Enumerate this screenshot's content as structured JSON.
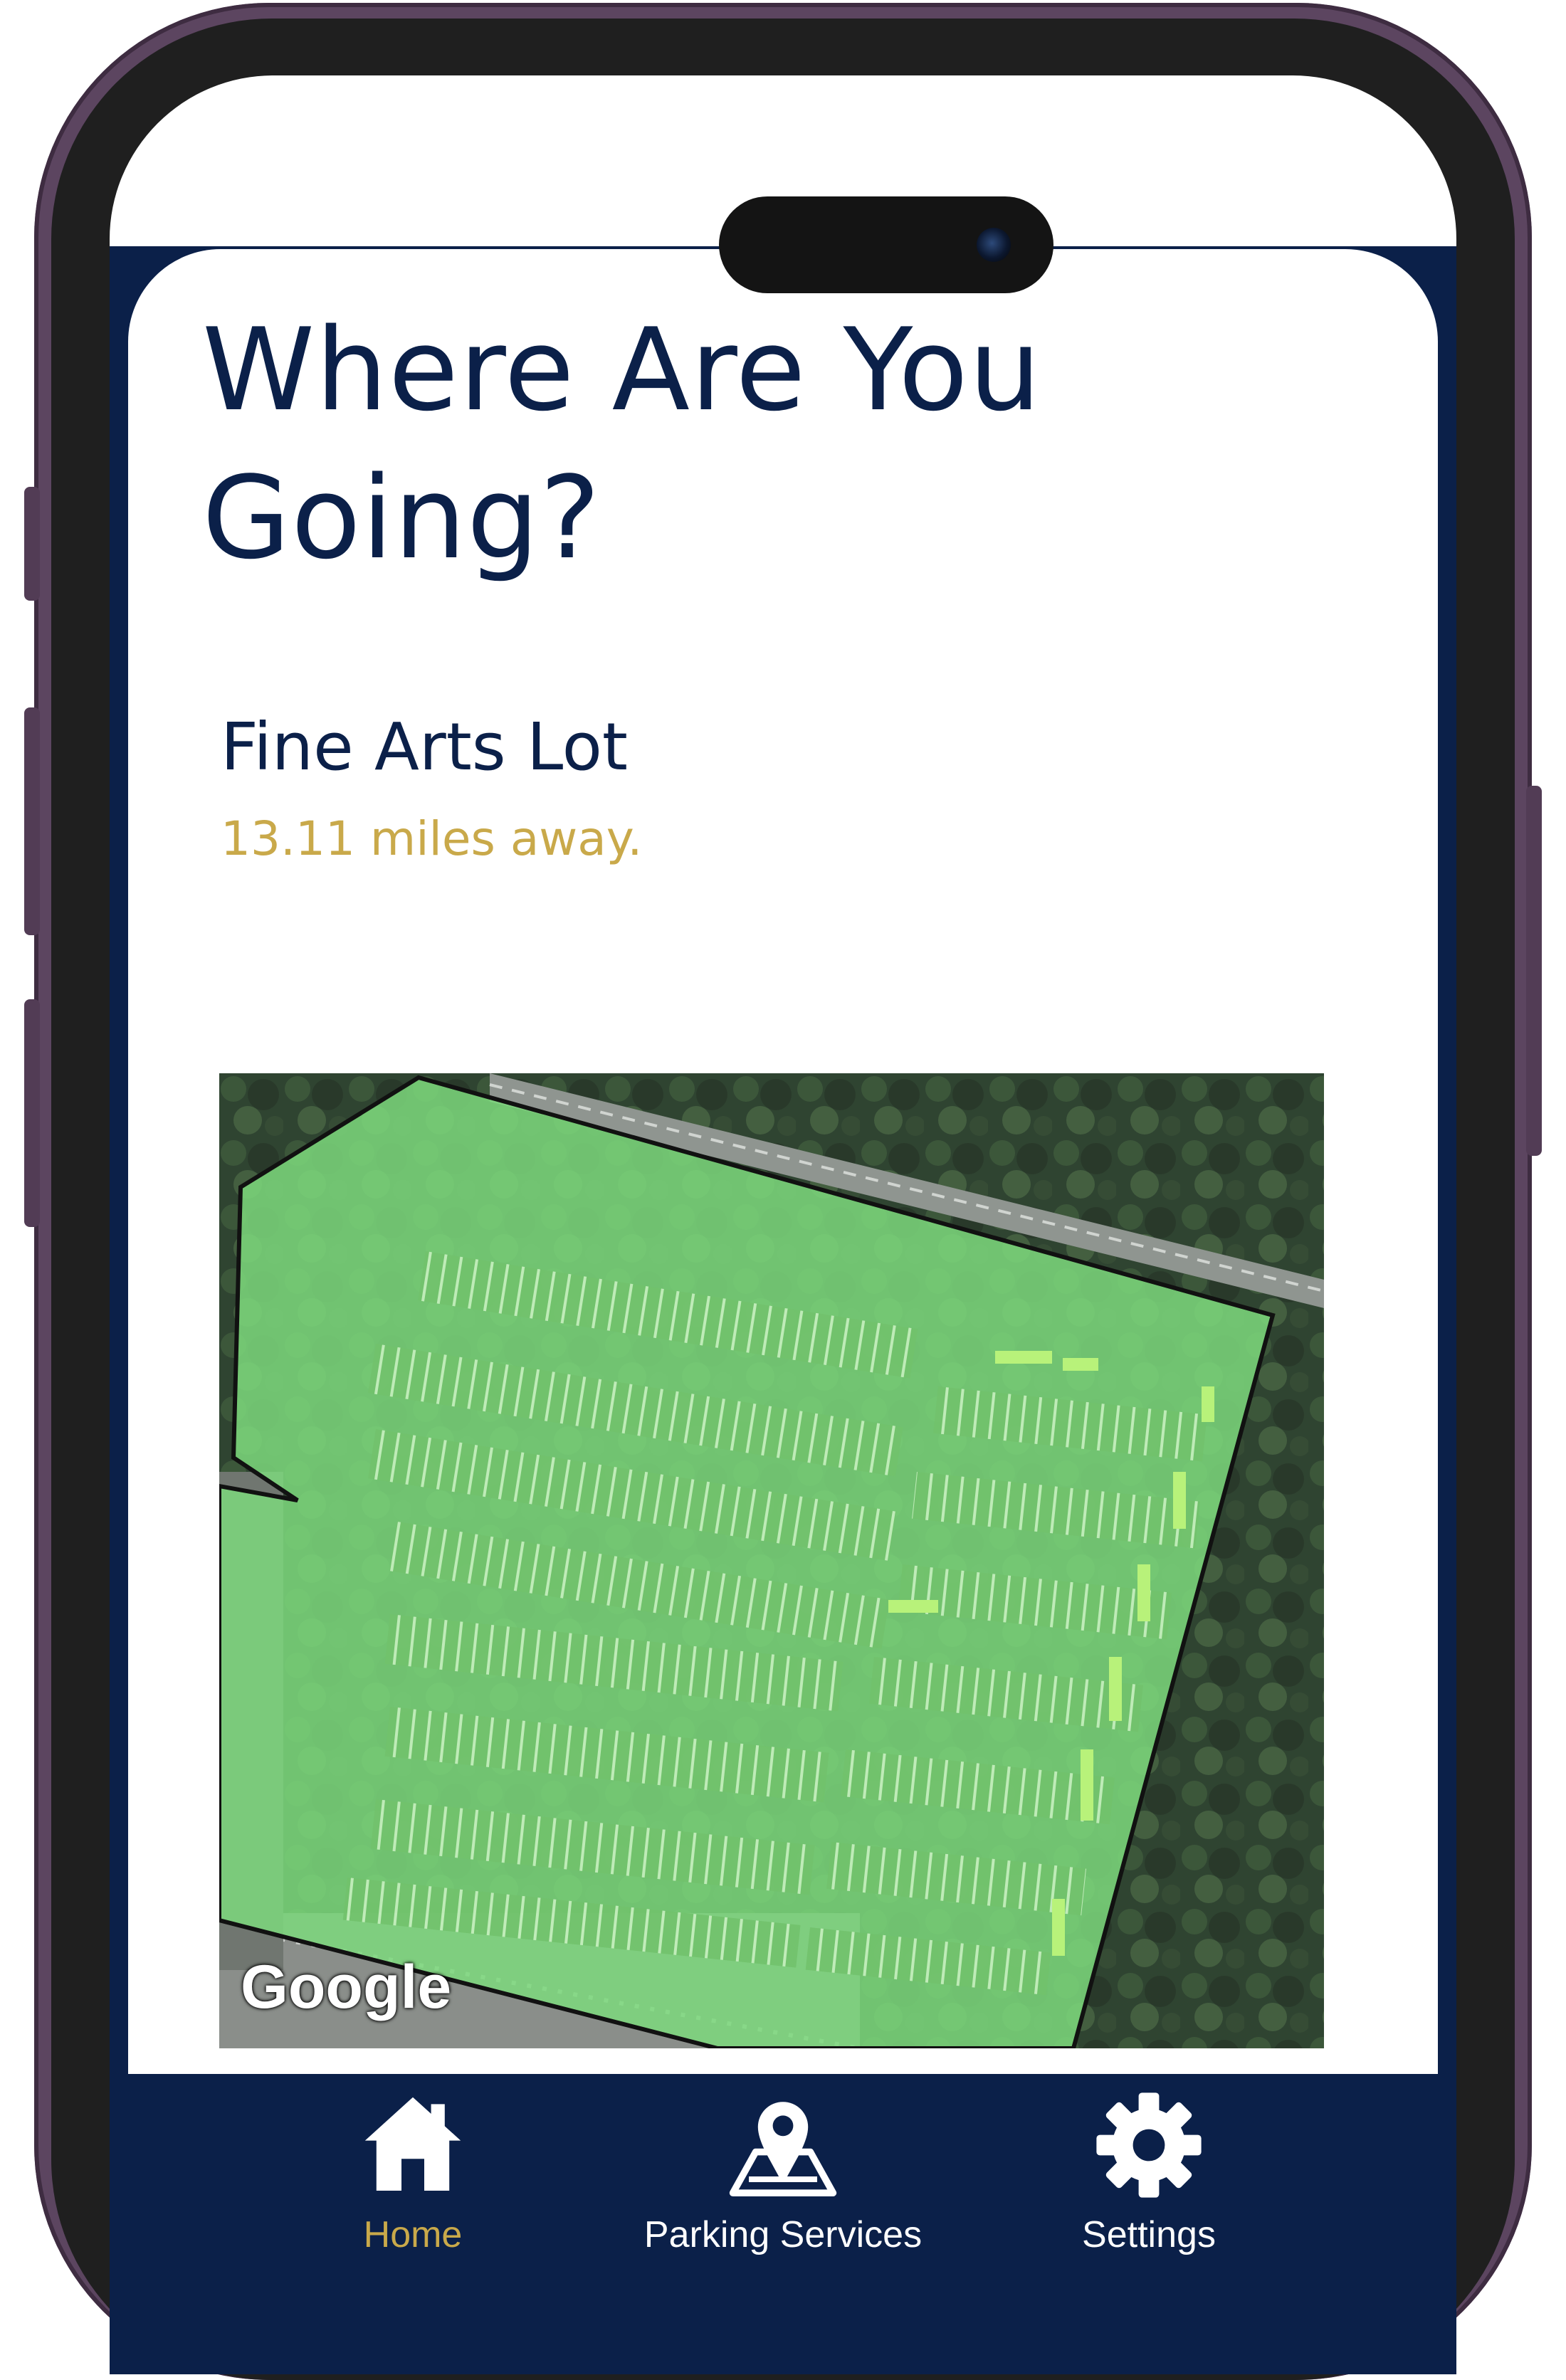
{
  "screen": {
    "title": "Where Are You Going?"
  },
  "lot": {
    "name": "Fine Arts Lot",
    "distance": "13.11 miles away.",
    "map_attribution": "Google",
    "highlight_color": "#7cd97c"
  },
  "nav": {
    "items": [
      {
        "label": "Home",
        "icon": "home-icon",
        "active": true
      },
      {
        "label": "Parking Services",
        "icon": "map-pin-icon",
        "active": false
      },
      {
        "label": "Settings",
        "icon": "gear-icon",
        "active": false
      }
    ]
  },
  "colors": {
    "primary": "#0b2049",
    "accent": "#c9a94a",
    "frame": "#5c4560"
  }
}
